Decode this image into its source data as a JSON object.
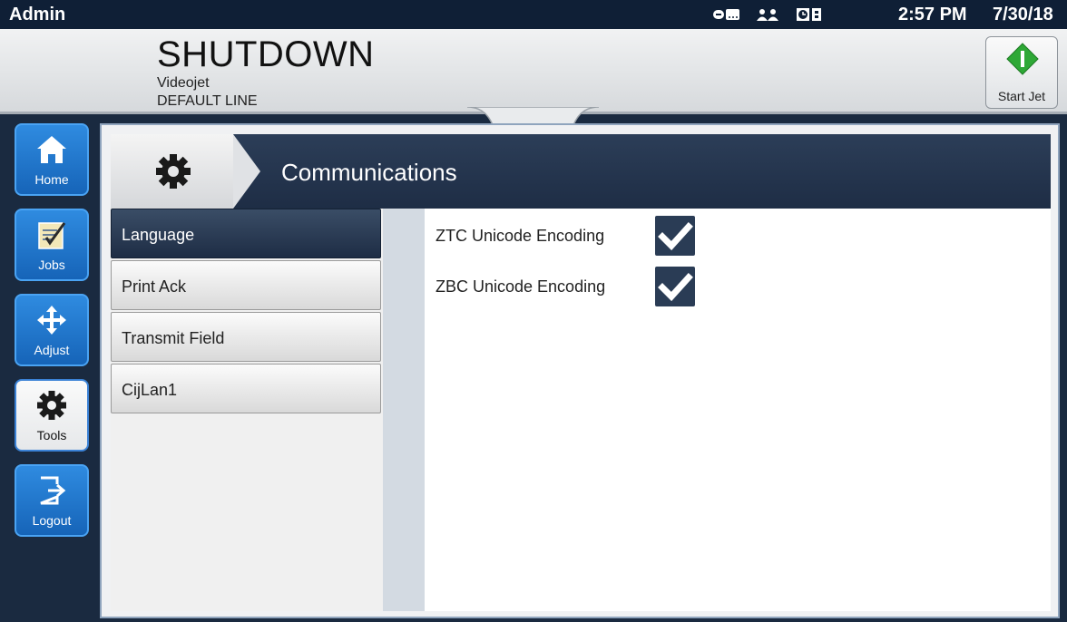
{
  "status": {
    "user": "Admin",
    "icons": [
      "connection-icon",
      "users-icon",
      "clock-status-icon"
    ],
    "time": "2:57 PM",
    "date": "7/30/18"
  },
  "header": {
    "state": "SHUTDOWN",
    "line1": "Videojet",
    "line2": "DEFAULT LINE",
    "start_button": "Start Jet"
  },
  "nav": [
    {
      "label": "Home",
      "icon": "home-icon"
    },
    {
      "label": "Jobs",
      "icon": "jobs-icon"
    },
    {
      "label": "Adjust",
      "icon": "move-arrows-icon"
    },
    {
      "label": "Tools",
      "icon": "gear-icon",
      "active": true
    },
    {
      "label": "Logout",
      "icon": "logout-icon"
    }
  ],
  "page": {
    "title": "Communications",
    "menu": [
      "Language",
      "Print Ack",
      "Transmit Field",
      "CijLan1"
    ],
    "selected_menu": "Language",
    "options": [
      {
        "label": "ZTC Unicode Encoding",
        "checked": true
      },
      {
        "label": "ZBC Unicode Encoding",
        "checked": true
      }
    ]
  },
  "colors": {
    "nav_button": "#1f74cc",
    "title_bar": "#243650",
    "start_green": "#2ea836"
  }
}
